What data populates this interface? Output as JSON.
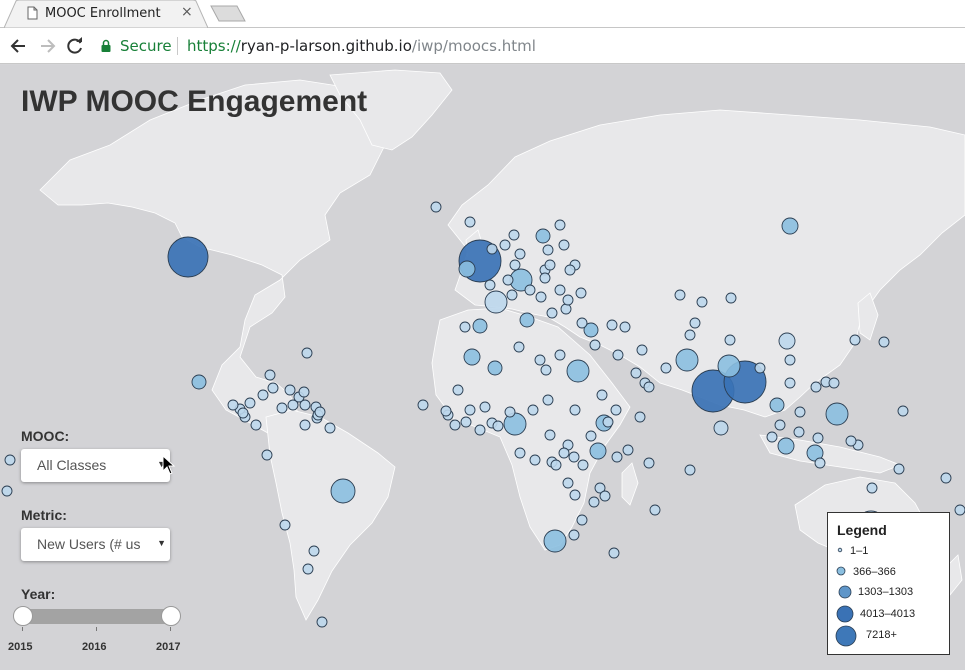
{
  "browser": {
    "tab_title": "MOOC Enrollment",
    "tab_close": "×",
    "secure_label": "Secure",
    "url_scheme": "https://",
    "url_host": "ryan-p-larson.github.io",
    "url_path": "/iwp/moocs.html"
  },
  "page": {
    "title": "IWP MOOC Engagement",
    "mooc_label": "MOOC:",
    "mooc_value": "All Classes",
    "metric_label": "Metric:",
    "metric_value": "New Users (# us",
    "year_label": "Year:",
    "year_ticks": [
      "2015",
      "2016",
      "2017"
    ],
    "year_range": [
      "2015",
      "2017"
    ]
  },
  "legend": {
    "title": "Legend",
    "items": [
      {
        "label": "1–1"
      },
      {
        "label": "366–366"
      },
      {
        "label": "1303–1303"
      },
      {
        "label": "4013–4013"
      },
      {
        "label": "7218+"
      }
    ]
  },
  "colors": {
    "land": "#e8e8ea",
    "ocean": "#d3d3d6",
    "bubble_light": "#bcd7ec",
    "bubble_mid": "#8bbfe0",
    "bubble_dark": "#3a72b5",
    "secure_green": "#188038"
  }
}
